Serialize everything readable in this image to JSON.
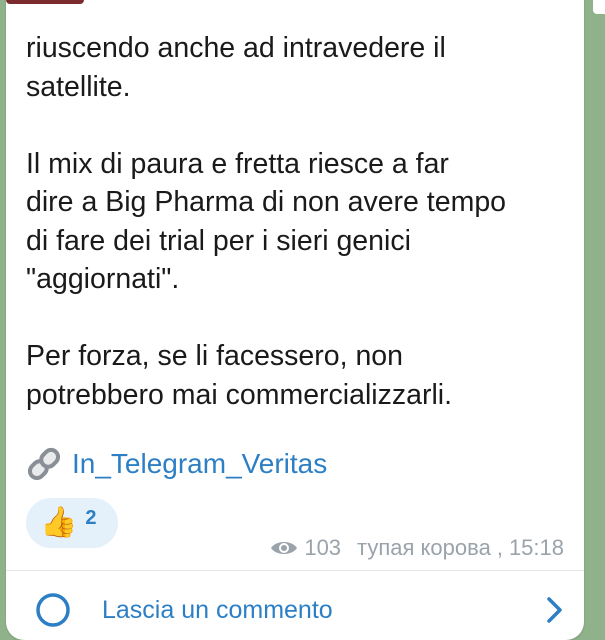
{
  "message": {
    "top_cut_text": "… . . . . . . . . . . . .",
    "paragraphs": [
      [
        "riuscendo anche ad intravedere il",
        "satellite."
      ],
      [
        "Il mix di paura e fretta riesce a far",
        "dire a Big Pharma di non avere tempo",
        "di fare dei trial per i sieri genici",
        "\"aggiornati\"."
      ],
      [
        "Per forza, se li facessero, non",
        "potrebbero mai commercializzarli."
      ]
    ],
    "link_text": "In_Telegram_Veritas"
  },
  "reaction": {
    "emoji": "👍",
    "count": "2"
  },
  "meta": {
    "views": "103",
    "author": "тупая корова",
    "time": "15:18"
  },
  "comments": {
    "label": "Lascia un commento"
  },
  "colors": {
    "link": "#2c7fc4",
    "meta": "#9aa3ab",
    "reaction_bg": "#e4f1fb"
  }
}
